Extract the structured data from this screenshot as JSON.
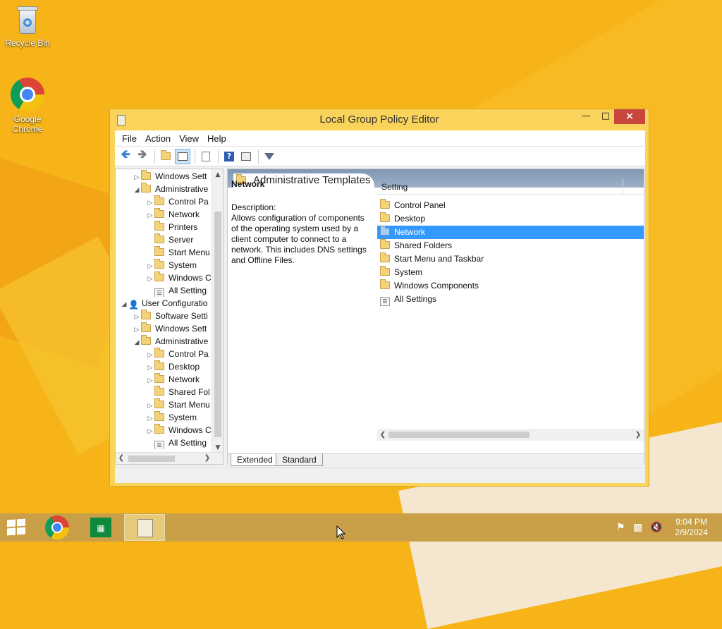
{
  "desktop": {
    "icons": [
      {
        "label": "Recycle Bin",
        "icon": "recycle-bin-icon"
      },
      {
        "label": "Google Chrome",
        "icon": "chrome-icon"
      }
    ]
  },
  "window": {
    "title": "Local Group Policy Editor",
    "menu": [
      "File",
      "Action",
      "View",
      "Help"
    ],
    "toolbar_icons": [
      "back-icon",
      "forward-icon",
      "up-folder-icon",
      "show-hide-tree-icon",
      "export-list-icon",
      "help-icon",
      "properties-icon",
      "filter-icon"
    ]
  },
  "tree": {
    "rows": [
      {
        "label": "Windows Sett",
        "expander": "▷"
      },
      {
        "label": "Administrative",
        "expander": "◢"
      },
      {
        "label": "Control Pa",
        "expander": "▷"
      },
      {
        "label": "Network",
        "expander": "▷"
      },
      {
        "label": "Printers",
        "expander": ""
      },
      {
        "label": "Server",
        "expander": ""
      },
      {
        "label": "Start Menu",
        "expander": ""
      },
      {
        "label": "System",
        "expander": "▷"
      },
      {
        "label": "Windows C",
        "expander": "▷"
      },
      {
        "label": "All Setting",
        "expander": ""
      },
      {
        "label": "User Configuratio",
        "expander": "◢"
      },
      {
        "label": "Software Setti",
        "expander": "▷"
      },
      {
        "label": "Windows Sett",
        "expander": "▷"
      },
      {
        "label": "Administrative",
        "expander": "◢"
      },
      {
        "label": "Control Pa",
        "expander": "▷"
      },
      {
        "label": "Desktop",
        "expander": "▷"
      },
      {
        "label": "Network",
        "expander": "▷"
      },
      {
        "label": "Shared Fol",
        "expander": ""
      },
      {
        "label": "Start Menu",
        "expander": "▷"
      },
      {
        "label": "System",
        "expander": "▷"
      },
      {
        "label": "Windows C",
        "expander": "▷"
      },
      {
        "label": "All Setting",
        "expander": ""
      }
    ]
  },
  "details": {
    "header": "Administrative Templates",
    "selected_name": "Network",
    "description_label": "Description:",
    "description_text": "Allows configuration of components of the operating system used by a client computer to connect to a network. This includes DNS settings and Offline Files.",
    "column_header": "Setting",
    "items": [
      "Control Panel",
      "Desktop",
      "Network",
      "Shared Folders",
      "Start Menu and Taskbar",
      "System",
      "Windows Components",
      "All Settings"
    ],
    "selected_item": "Network",
    "tabs": [
      "Extended",
      "Standard"
    ]
  },
  "taskbar": {
    "time": "9:04 PM",
    "date": "2/9/2024",
    "tray_icons": [
      "flag-icon",
      "network-icon",
      "volume-muted-icon"
    ]
  }
}
